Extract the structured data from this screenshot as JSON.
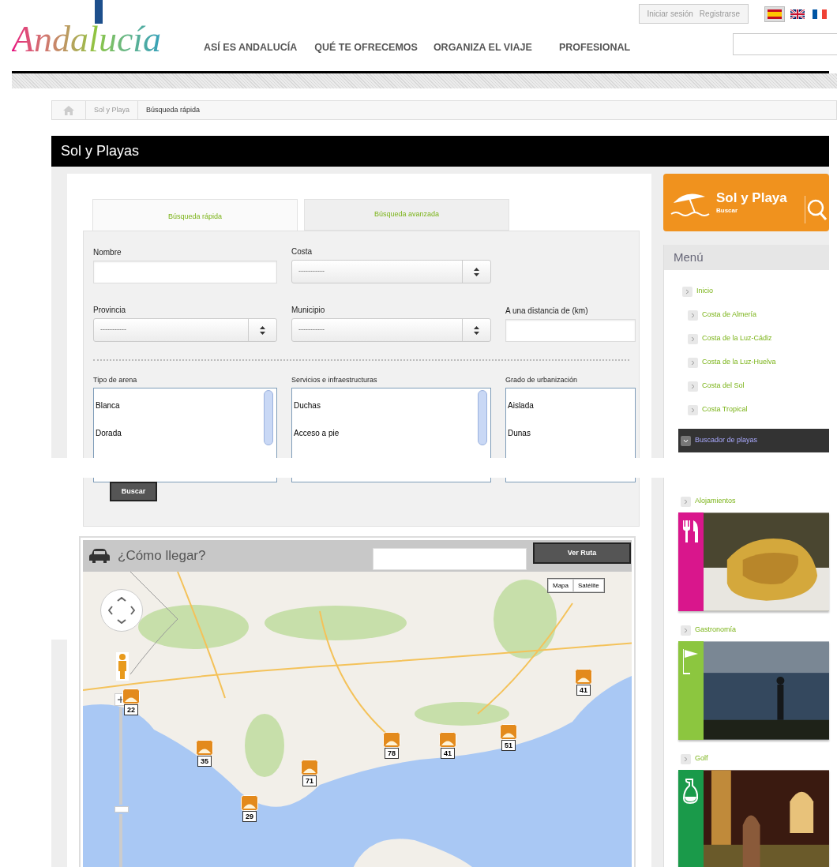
{
  "header": {
    "logo": "Andalucía",
    "account_links": [
      "Iniciar sesión",
      "Registrarse"
    ],
    "languages": [
      {
        "kind": "es",
        "selected": true
      },
      {
        "kind": "uk",
        "selected": false
      },
      {
        "kind": "fr",
        "selected": false
      }
    ],
    "nav": [
      "ASÍ ES ANDALUCÍA",
      "QUÉ TE OFRECEMOS",
      "ORGANIZA EL VIAJE",
      "PROFESIONAL"
    ]
  },
  "breadcrumb": [
    "Sol y Playa",
    "Búsqueda rápida"
  ],
  "page_title": "Sol y Playas",
  "search_tabs": [
    {
      "label": "Búsqueda rápida",
      "selected": true
    },
    {
      "label": "Búsqueda avanzada",
      "selected": false
    }
  ],
  "form": {
    "fields": [
      {
        "kind": "text",
        "label": "Nombre"
      },
      {
        "kind": "select",
        "label": "Costa",
        "value": "-----------"
      },
      {
        "kind": "none"
      },
      {
        "kind": "select",
        "label": "Provincia",
        "value": "-----------"
      },
      {
        "kind": "select",
        "label": "Municipio",
        "value": "-----------"
      },
      {
        "kind": "text",
        "label": "A una distancia de (km)"
      }
    ],
    "lists": [
      {
        "label": "Tipo de arena",
        "scrollable": true,
        "options": [
          "Blanca",
          "Dorada"
        ]
      },
      {
        "label": "Servicios e infraestructuras",
        "scrollable": true,
        "options": [
          "Duchas",
          "Acceso a pie"
        ]
      },
      {
        "label": "Grado de urbanización",
        "scrollable": false,
        "options": [
          "Aislada",
          "Dunas"
        ]
      }
    ],
    "submit": "Buscar"
  },
  "route": {
    "title": "¿Cómo llegar?",
    "button": "Ver Ruta",
    "map_types": [
      "Mapa",
      "Satélite"
    ],
    "markers": [
      "22",
      "35",
      "71",
      "29",
      "78",
      "41",
      "51",
      "41"
    ]
  },
  "sidebar": {
    "banner": {
      "title": "Sol y Playa",
      "subtitle": "Buscar"
    },
    "menu": {
      "title": "Menú",
      "items": [
        {
          "label": "Inicio",
          "selected": false,
          "children": [
            {
              "label": "Costa de Almería",
              "selected": false
            },
            {
              "label": "Costa de la Luz-Cádiz",
              "selected": false
            },
            {
              "label": "Costa de la Luz-Huelva",
              "selected": false
            },
            {
              "label": "Costa del Sol",
              "selected": false
            },
            {
              "label": "Costa Tropical",
              "selected": false
            }
          ]
        },
        {
          "label": "Buscador de playas",
          "selected": true
        }
      ]
    },
    "links": [
      "Alojamientos",
      "Gastronomía",
      "Golf"
    ],
    "cards": [
      {
        "color": "#d9168c"
      },
      {
        "color": "#8cc63f"
      },
      {
        "color": "#1a9a4a"
      }
    ]
  }
}
